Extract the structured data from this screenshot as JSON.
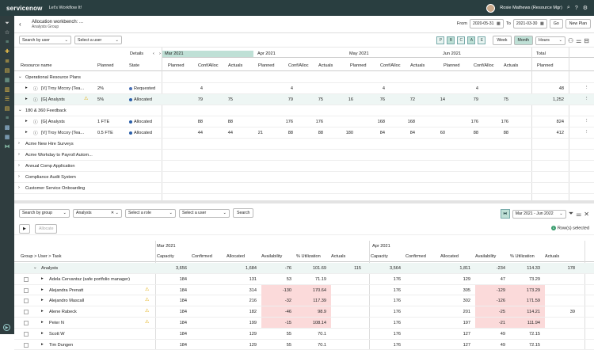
{
  "topbar": {
    "logo": "servicenow",
    "tagline": "Let's Workflow It!",
    "user": "Rosie Mathews (Resource Mgr)"
  },
  "header": {
    "title": "Allocation workbench: ...",
    "subtitle": "Analysts Group",
    "from_label": "From",
    "from_date": "2020-05-31",
    "to_label": "To",
    "to_date": "2021-03-30",
    "go": "Go",
    "new_plan": "New Plan"
  },
  "toolbar1": {
    "search_by": "Search by user",
    "select_user": "Select a user",
    "pills": [
      "P",
      "B",
      "C",
      "A",
      "E"
    ],
    "week": "Week",
    "month": "Month",
    "units": "Hours"
  },
  "grid1": {
    "headers": {
      "details": "Details",
      "resource_name": "Resource name",
      "planned": "Planned",
      "state": "State",
      "total": "Total",
      "total_planned": "Planned"
    },
    "months": [
      "Mar 2021",
      "Apr 2021",
      "May 2021",
      "Jun 2021"
    ],
    "subcols": [
      "Planned",
      "Conf/Alloc",
      "Actuals"
    ],
    "rows": [
      {
        "name": "Operational Resource Plans",
        "planned": "",
        "state": "",
        "vals": [
          "",
          "",
          "",
          "",
          "",
          "",
          "",
          "",
          "",
          "",
          ""
        ],
        "total": ""
      },
      {
        "name": "[V] Troy Mccoy (Tea...",
        "planned": "2%",
        "state": "Requested",
        "vals": [
          "4",
          "",
          "",
          "4",
          "",
          "",
          "4",
          "",
          "",
          "4",
          ""
        ],
        "total": "48"
      },
      {
        "name": "[G] Analysts",
        "planned": "5%",
        "state": "Allocated",
        "vals": [
          "79",
          "75",
          "",
          "79",
          "75",
          "16",
          "76",
          "72",
          "14",
          "79",
          "75"
        ],
        "total": "1,252"
      },
      {
        "name": "180 & 360 Feedback",
        "planned": "",
        "state": "",
        "vals": [
          "",
          "",
          "",
          "",
          "",
          "",
          "",
          "",
          "",
          "",
          ""
        ],
        "total": ""
      },
      {
        "name": "[G] Analysts",
        "planned": "1 FTE",
        "state": "Allocated",
        "vals": [
          "88",
          "88",
          "",
          "176",
          "176",
          "",
          "168",
          "168",
          "",
          "176",
          "176"
        ],
        "total": "824"
      },
      {
        "name": "[V] Troy Mccoy (Tea...",
        "planned": "0.5 FTE",
        "state": "Allocated",
        "vals": [
          "44",
          "44",
          "21",
          "88",
          "88",
          "180",
          "84",
          "84",
          "60",
          "88",
          "88"
        ],
        "total": "412"
      },
      {
        "name": "Acme New Hire Surveys",
        "planned": "",
        "state": "",
        "vals": [
          "",
          "",
          "",
          "",
          "",
          "",
          "",
          "",
          "",
          "",
          ""
        ],
        "total": ""
      },
      {
        "name": "Acme Workday to Payroll Autom...",
        "planned": "",
        "state": "",
        "vals": [
          "",
          "",
          "",
          "",
          "",
          "",
          "",
          "",
          "",
          "",
          ""
        ],
        "total": ""
      },
      {
        "name": "Annual Comp Application",
        "planned": "",
        "state": "",
        "vals": [
          "",
          "",
          "",
          "",
          "",
          "",
          "",
          "",
          "",
          "",
          ""
        ],
        "total": ""
      },
      {
        "name": "Compliance Audit System",
        "planned": "",
        "state": "",
        "vals": [
          "",
          "",
          "",
          "",
          "",
          "",
          "",
          "",
          "",
          "",
          ""
        ],
        "total": ""
      },
      {
        "name": "Customer Service Onboarding",
        "planned": "",
        "state": "",
        "vals": [
          "",
          "",
          "",
          "",
          "",
          "",
          "",
          "",
          "",
          "",
          ""
        ],
        "total": ""
      }
    ]
  },
  "toolbar2": {
    "search_by": "Search by group",
    "group": "Analysts",
    "select_role": "Select a role",
    "select_user": "Select a user",
    "search": "Search",
    "date_range": "Mar 2021 - Jun 2022"
  },
  "toolbar3": {
    "allocate": "Allocate",
    "rows_selected": "Row(s) selected",
    "count": "1"
  },
  "grid2": {
    "group_header": "Group > User > Task",
    "months": [
      "Mar 2021",
      "Apr 2021"
    ],
    "cols": [
      "Capacity",
      "Confirmed",
      "Allocated",
      "Availability",
      "% Utilization",
      "Actuals"
    ],
    "rows": [
      {
        "name": "Analysts",
        "vals": [
          "3,656",
          "",
          "1,684",
          "-76",
          "101.69",
          "115",
          "3,564",
          "",
          "1,811",
          "-234",
          "114.33",
          "178"
        ]
      },
      {
        "name": "Adela Cervantsz (safe portfolio manager)",
        "vals": [
          "184",
          "",
          "131",
          "53",
          "71.19",
          "",
          "176",
          "",
          "129",
          "47",
          "73.29",
          ""
        ]
      },
      {
        "name": "Alejandra Prenatt",
        "vals": [
          "184",
          "",
          "314",
          "-130",
          "170.64",
          "",
          "176",
          "",
          "305",
          "-129",
          "173.29",
          ""
        ]
      },
      {
        "name": "Alejandro Mascall",
        "vals": [
          "184",
          "",
          "216",
          "-32",
          "117.39",
          "",
          "176",
          "",
          "302",
          "-126",
          "171.59",
          ""
        ]
      },
      {
        "name": "Alene Rabeck",
        "vals": [
          "184",
          "",
          "182",
          "-46",
          "98.9",
          "",
          "176",
          "",
          "201",
          "-25",
          "114.21",
          "39"
        ]
      },
      {
        "name": "Peter N",
        "vals": [
          "184",
          "",
          "199",
          "-15",
          "108.14",
          "",
          "176",
          "",
          "197",
          "-21",
          "111.94",
          ""
        ]
      },
      {
        "name": "Scott W",
        "vals": [
          "184",
          "",
          "129",
          "55",
          "70.1",
          "",
          "176",
          "",
          "127",
          "49",
          "72.15",
          ""
        ]
      },
      {
        "name": "Tim Dungen",
        "vals": [
          "184",
          "",
          "129",
          "55",
          "70.1",
          "",
          "176",
          "",
          "127",
          "49",
          "72.15",
          ""
        ]
      }
    ]
  }
}
